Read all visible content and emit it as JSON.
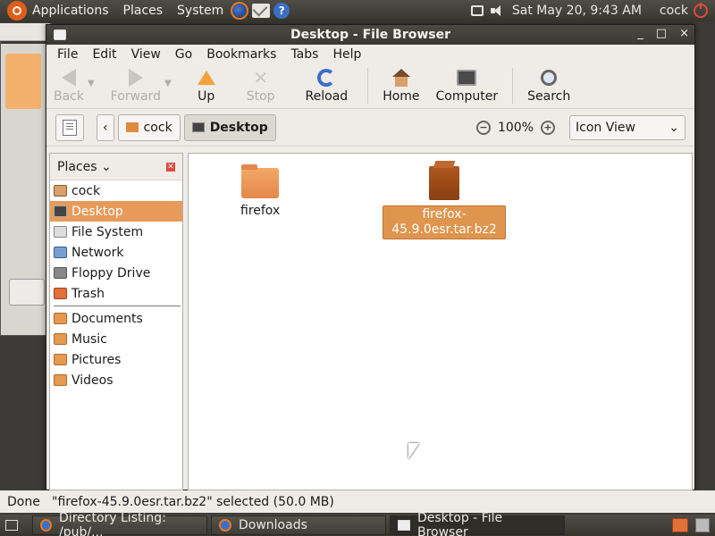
{
  "top_panel": {
    "menus": [
      "Applications",
      "Places",
      "System"
    ],
    "clock": "Sat May 20,  9:43 AM",
    "user": "cock"
  },
  "window": {
    "title": "Desktop - File Browser",
    "controls": [
      "_",
      "□",
      "×"
    ],
    "menubar": [
      "File",
      "Edit",
      "View",
      "Go",
      "Bookmarks",
      "Tabs",
      "Help"
    ],
    "toolbar": {
      "back": "Back",
      "forward": "Forward",
      "up": "Up",
      "stop": "Stop",
      "reload": "Reload",
      "home": "Home",
      "computer": "Computer",
      "search": "Search"
    },
    "location": {
      "back_arrow": "‹",
      "crumbs": [
        "cock",
        "Desktop"
      ],
      "zoom_level": "100%",
      "view_mode": "Icon View"
    }
  },
  "sidebar": {
    "title": "Places",
    "places": [
      {
        "label": "cock",
        "icon": "home-icon"
      },
      {
        "label": "Desktop",
        "icon": "desktop-icon",
        "selected": true
      },
      {
        "label": "File System",
        "icon": "filesystem-icon"
      },
      {
        "label": "Network",
        "icon": "network-icon"
      },
      {
        "label": "Floppy Drive",
        "icon": "floppy-icon"
      },
      {
        "label": "Trash",
        "icon": "trash-icon"
      }
    ],
    "bookmarks": [
      {
        "label": "Documents",
        "icon": "folder-icon"
      },
      {
        "label": "Music",
        "icon": "folder-icon"
      },
      {
        "label": "Pictures",
        "icon": "folder-icon"
      },
      {
        "label": "Videos",
        "icon": "folder-icon"
      }
    ]
  },
  "files": [
    {
      "name": "firefox",
      "type": "folder"
    },
    {
      "name": "firefox-45.9.0esr.tar.bz2",
      "type": "archive",
      "selected": true
    }
  ],
  "status": {
    "left": "Done",
    "message": "\"firefox-45.9.0esr.tar.bz2\" selected (50.0 MB)"
  },
  "taskbar": {
    "tasks": [
      "Directory Listing: /pub/...",
      "Downloads",
      "Desktop - File Browser"
    ]
  },
  "colors": {
    "selection": "#e89a5b",
    "panel": "#3c3b37",
    "accent": "#e25c1a"
  }
}
